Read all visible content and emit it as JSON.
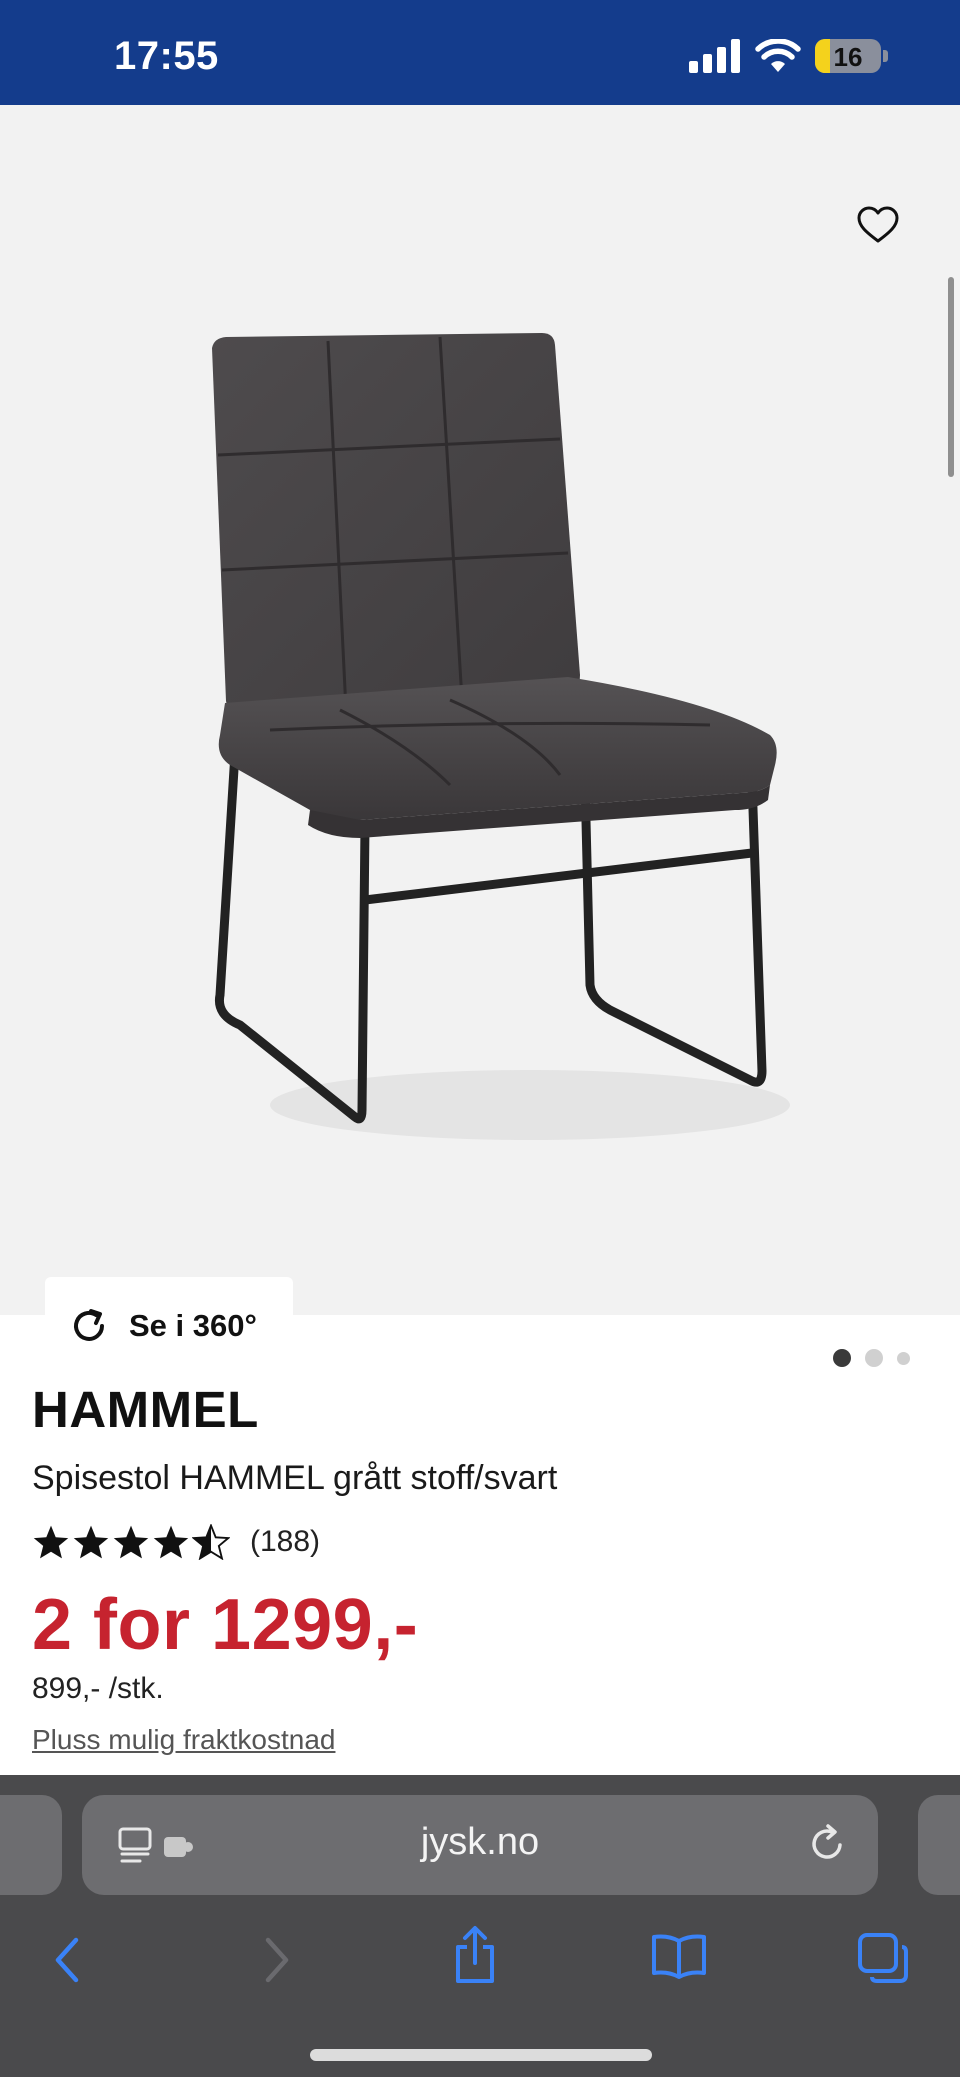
{
  "status_bar": {
    "time": "17:55",
    "battery": "16",
    "icons": [
      "cellular-signal-icon",
      "wifi-icon",
      "battery-icon"
    ],
    "background": "#143c8c"
  },
  "gallery": {
    "button_360_label": "Se i 360°",
    "dots_count": 3,
    "active_dot": 0,
    "icons": [
      "heart-icon",
      "rotate-icon"
    ]
  },
  "product": {
    "brand": "HAMMEL",
    "subtitle": "Spisestol HAMMEL grått stoff/svart",
    "rating_value": 4.5,
    "rating_count": "(188)",
    "price": "2 for 1299,-",
    "unit_price": "899,- /stk.",
    "shipping_link": "Pluss mulig fraktkostnad",
    "price_color": "#c6232f"
  },
  "browser": {
    "url": "jysk.no",
    "toolbar_icons": [
      "back-icon",
      "forward-icon",
      "share-icon",
      "bookmarks-icon",
      "tabs-icon"
    ],
    "accent": "#3a82f7"
  }
}
